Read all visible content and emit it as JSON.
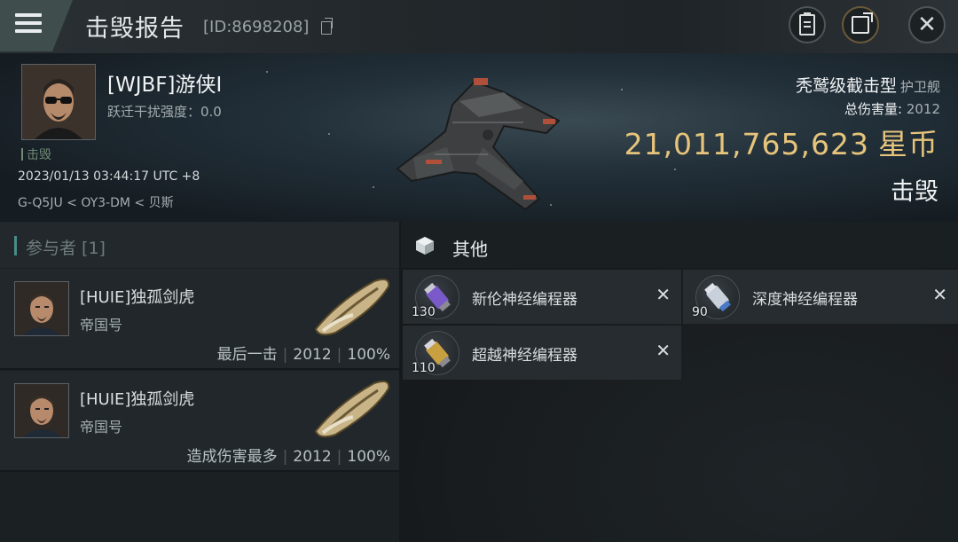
{
  "header": {
    "title": "击毁报告",
    "report_id": "[ID:8698208]"
  },
  "victim": {
    "name": "[WJBF]游侠I",
    "warp_scram": "跃迁干扰强度：0.0",
    "status_small": "击毁",
    "datetime": "2023/01/13 03:44:17 UTC +8",
    "location": "G-Q5JU < OY3-DM < 贝斯",
    "ship_name": "秃鹫级截击型",
    "ship_class": "护卫舰",
    "total_damage_label": "总伤害量:",
    "total_damage_value": "2012",
    "isk_value": "21,011,765,623",
    "isk_unit": "星币",
    "result": "击毁"
  },
  "participants": {
    "title": "参与者 [1]",
    "rows": [
      {
        "name": "[HUIE]独孤剑虎",
        "ship": "帝国号",
        "role": "最后一击",
        "damage": "2012",
        "percent": "100%"
      },
      {
        "name": "[HUIE]独孤剑虎",
        "ship": "帝国号",
        "role": "造成伤害最多",
        "damage": "2012",
        "percent": "100%"
      }
    ]
  },
  "other": {
    "title": "其他",
    "items": [
      {
        "name": "新伦神经编程器",
        "qty": "130",
        "color": "#7a5ac8"
      },
      {
        "name": "深度神经编程器",
        "qty": "90",
        "color": "#4a78c8"
      },
      {
        "name": "超越神经编程器",
        "qty": "110",
        "color": "#c8a040"
      }
    ]
  }
}
